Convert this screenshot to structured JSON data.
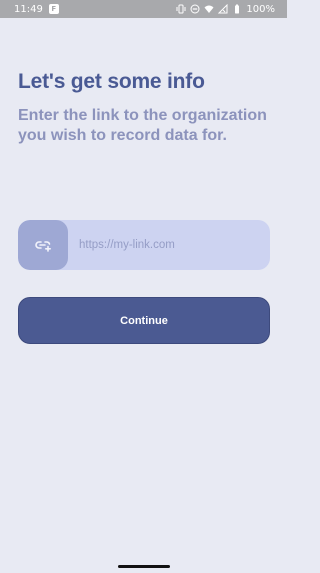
{
  "status_bar": {
    "time": "11:49",
    "app_badge": "F",
    "battery": "100%",
    "icons": [
      "vibrate-icon",
      "dnd-icon",
      "wifi-icon",
      "signal-icon",
      "battery-icon"
    ]
  },
  "page": {
    "title": "Let's get some info",
    "subtitle": "Enter the link to the organization you wish to record data for."
  },
  "link_field": {
    "icon": "link-add-icon",
    "placeholder": "https://my-link.com",
    "value": ""
  },
  "continue_button": {
    "label": "Continue"
  },
  "colors": {
    "background": "#e8eaf3",
    "title": "#4a5a94",
    "subtitle": "#8c93bc",
    "field": "#cdd3f1",
    "field_icon_box": "#9ea8d4",
    "button": "#4b5a92",
    "status_bar": "#a8a9ac"
  }
}
